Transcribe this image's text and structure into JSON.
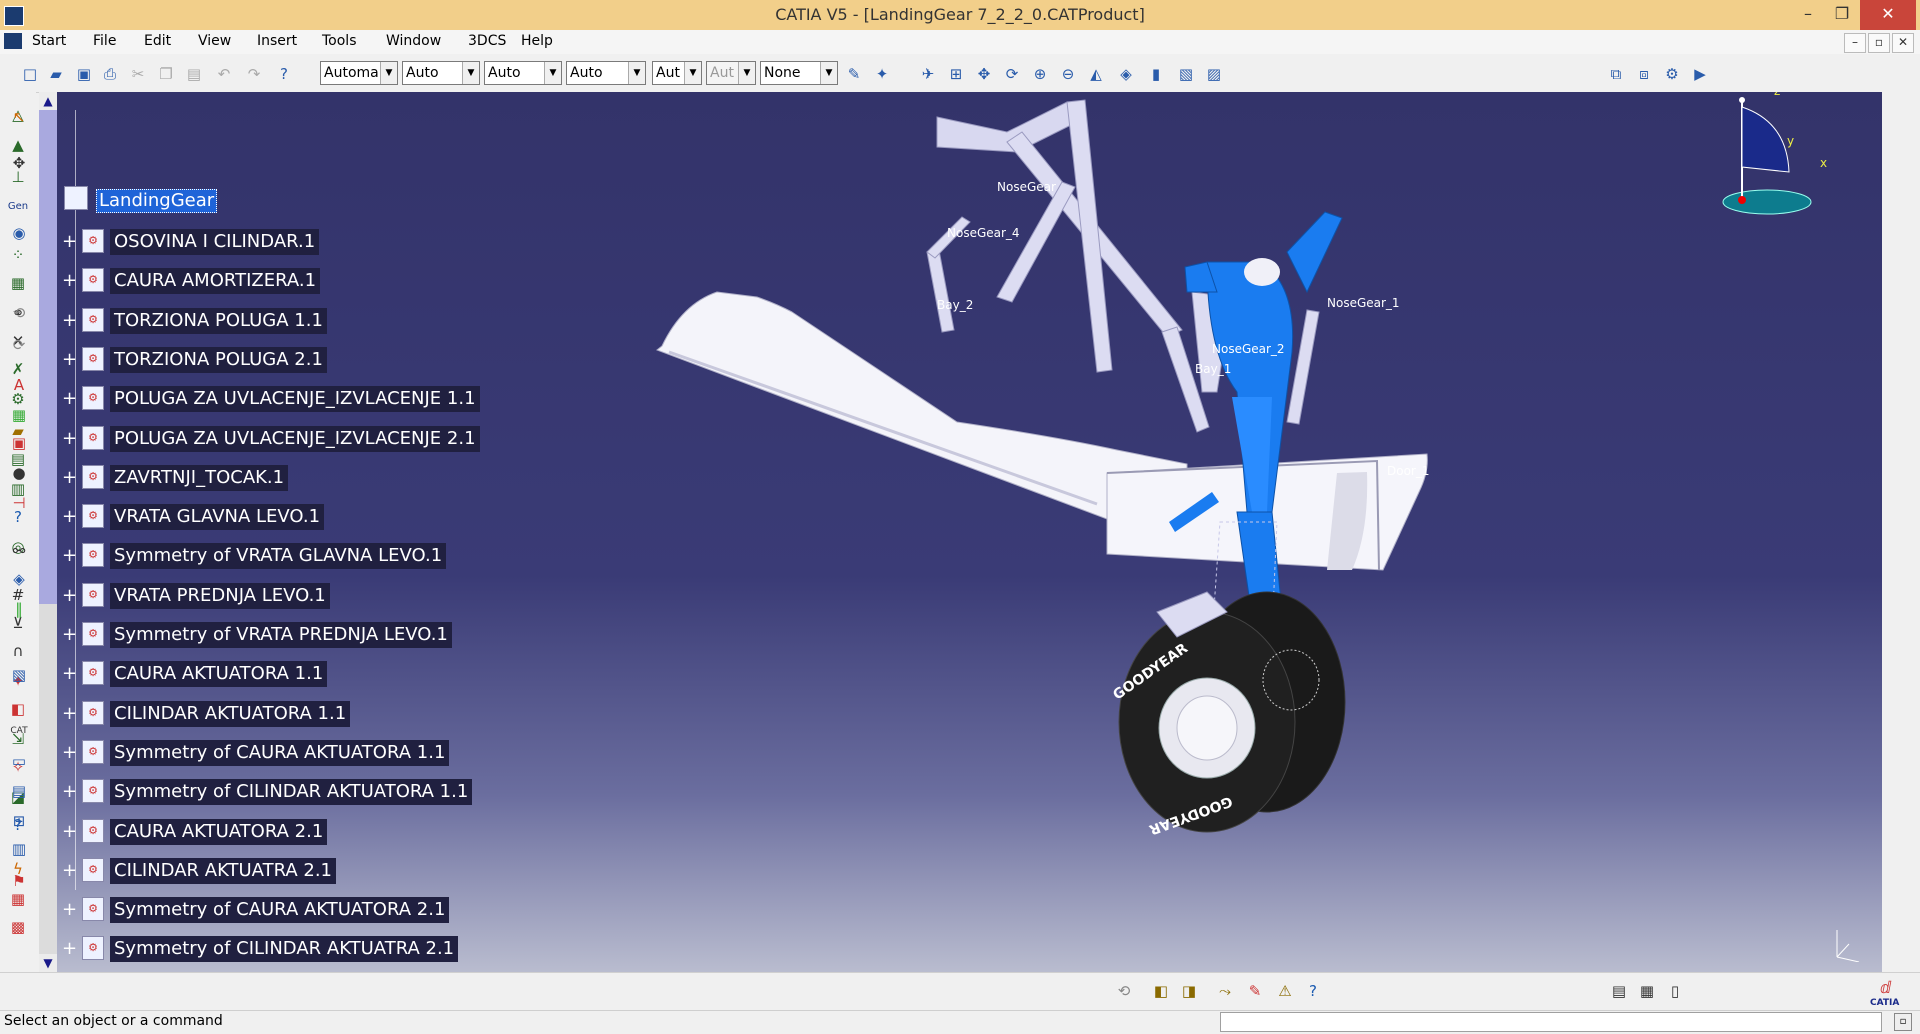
{
  "window": {
    "title": "CATIA V5 - [LandingGear 7_2_2_0.CATProduct]",
    "controls": [
      "–",
      "❐",
      "✕"
    ]
  },
  "menu": {
    "items": [
      "Start",
      "File",
      "Edit",
      "View",
      "Insert",
      "Tools",
      "Window",
      "3DCS",
      "Help"
    ],
    "mdi_controls": [
      "–",
      "▫",
      "✕"
    ]
  },
  "toolbar": {
    "combos": [
      {
        "value": "Automa",
        "enabled": true
      },
      {
        "value": "Auto",
        "enabled": true
      },
      {
        "value": "Auto",
        "enabled": true
      },
      {
        "value": "Auto",
        "enabled": true
      },
      {
        "value": "Aut",
        "enabled": true
      },
      {
        "value": "Aut",
        "enabled": false
      },
      {
        "value": "None",
        "enabled": true
      }
    ]
  },
  "tree": {
    "root": "LandingGear",
    "items": [
      "OSOVINA I CILINDAR.1",
      "CAURA AMORTIZERA.1",
      "TORZIONA POLUGA 1.1",
      "TORZIONA POLUGA 2.1",
      "POLUGA ZA UVLACENJE_IZVLACENJE 1.1",
      "POLUGA ZA UVLACENJE_IZVLACENJE 2.1",
      "ZAVRTNJI_TOCAK.1",
      "VRATA GLAVNA LEVO.1",
      "Symmetry of VRATA GLAVNA LEVO.1",
      "VRATA PREDNJA LEVO.1",
      "Symmetry of VRATA PREDNJA LEVO.1",
      "CAURA AKTUATORA 1.1",
      "CILINDAR AKTUATORA 1.1",
      "Symmetry of CAURA AKTUATORA 1.1",
      "Symmetry of CILINDAR AKTUATORA 1.1",
      "CAURA AKTUATORA 2.1",
      "CILINDAR AKTUATRA 2.1",
      "Symmetry of CAURA AKTUATORA 2.1",
      "Symmetry of CILINDAR AKTUATRA 2.1"
    ]
  },
  "model_labels": {
    "nosegear_top": "NoseGear",
    "nosegear_4": "NoseGear_4",
    "bay_2": "Bay_2",
    "nosegear_1": "NoseGear_1",
    "nosegear_2": "NoseGear_2",
    "bay_1": "Bay_1",
    "door_1": "Door_1",
    "tire_brand_top": "GOODYEAR",
    "tire_brand_bottom": "GOODYEAR"
  },
  "compass": {
    "z": "z",
    "y": "y",
    "x": "x"
  },
  "status": {
    "text": "Select an object or a command"
  },
  "brand": {
    "name": "CATIA"
  },
  "colors": {
    "viewport_top": "#33336a",
    "part_blue": "#1a7cf0",
    "door_white": "#f4f4fa",
    "selection": "#1f64d8"
  }
}
